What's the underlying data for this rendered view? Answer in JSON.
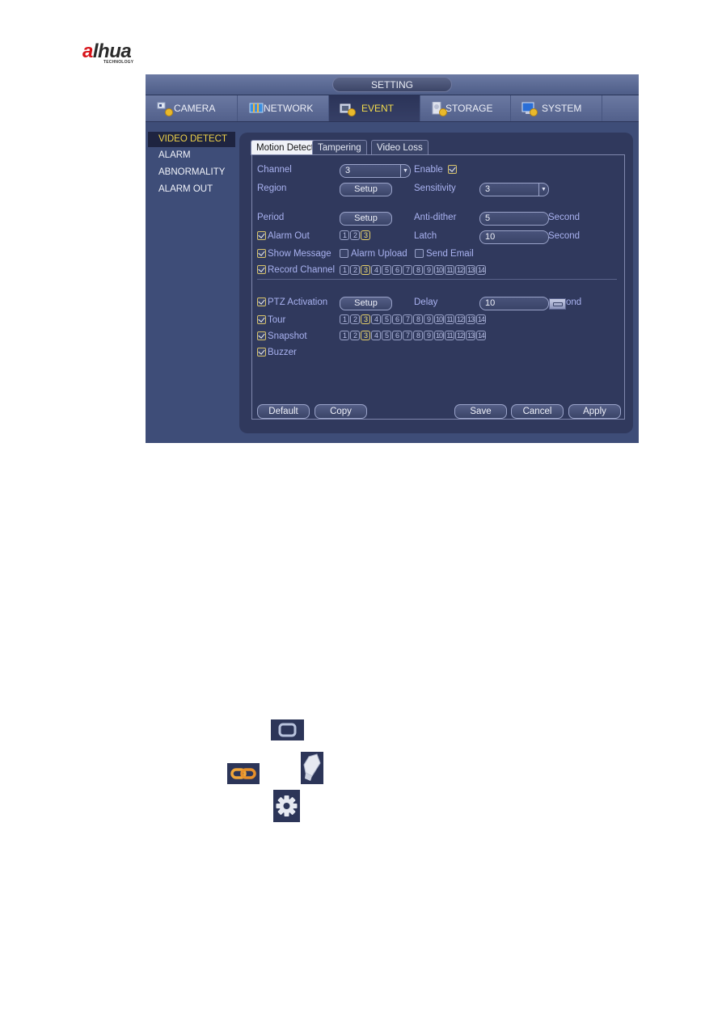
{
  "logo": {
    "brand": "alhua",
    "brand_accent": "a",
    "brand_rest": "lhua",
    "tagline": "TECHNOLOGY"
  },
  "window": {
    "title": "SETTING",
    "tabs": [
      {
        "label": "CAMERA",
        "icon": "camera-settings-icon",
        "active": false
      },
      {
        "label": "NETWORK",
        "icon": "network-icon",
        "active": false
      },
      {
        "label": "EVENT",
        "icon": "event-icon",
        "active": true
      },
      {
        "label": "STORAGE",
        "icon": "storage-icon",
        "active": false
      },
      {
        "label": "SYSTEM",
        "icon": "system-monitor-icon",
        "active": false
      }
    ],
    "active_color": "#f3dc4c"
  },
  "sidebar": {
    "items": [
      {
        "label": "VIDEO DETECT",
        "active": true
      },
      {
        "label": "ALARM",
        "active": false
      },
      {
        "label": "ABNORMALITY",
        "active": false
      },
      {
        "label": "ALARM OUT",
        "active": false
      }
    ]
  },
  "subtabs": [
    {
      "label": "Motion Detect",
      "active": true
    },
    {
      "label": "Tampering",
      "active": false
    },
    {
      "label": "Video Loss",
      "active": false
    }
  ],
  "form": {
    "channel": {
      "label": "Channel",
      "value": "3"
    },
    "enable": {
      "label": "Enable",
      "checked": true
    },
    "region": {
      "label": "Region",
      "button": "Setup"
    },
    "sensitivity": {
      "label": "Sensitivity",
      "value": "3"
    },
    "period": {
      "label": "Period",
      "button": "Setup"
    },
    "anti_dither": {
      "label": "Anti-dither",
      "value": "5",
      "unit": "Second"
    },
    "alarm_out": {
      "label": "Alarm Out",
      "checked": true,
      "options": [
        "1",
        "2",
        "3"
      ],
      "selected": [
        "3"
      ]
    },
    "latch": {
      "label": "Latch",
      "value": "10",
      "unit": "Second"
    },
    "show_message": {
      "label": "Show Message",
      "checked": true
    },
    "alarm_upload": {
      "label": "Alarm Upload",
      "checked": false
    },
    "send_email": {
      "label": "Send Email",
      "checked": false
    },
    "record_channel": {
      "label": "Record Channel",
      "checked": true,
      "options": [
        "1",
        "2",
        "3",
        "4",
        "5",
        "6",
        "7",
        "8",
        "9",
        "10",
        "11",
        "12",
        "13",
        "14"
      ],
      "selected": [
        "3"
      ]
    },
    "ptz_activation": {
      "label": "PTZ Activation",
      "checked": true,
      "button": "Setup"
    },
    "delay": {
      "label": "Delay",
      "value": "10",
      "unit_visible": "ond"
    },
    "tour": {
      "label": "Tour",
      "checked": true,
      "options": [
        "1",
        "2",
        "3",
        "4",
        "5",
        "6",
        "7",
        "8",
        "9",
        "10",
        "11",
        "12",
        "13",
        "14"
      ],
      "selected": [
        "3"
      ]
    },
    "snapshot": {
      "label": "Snapshot",
      "checked": true,
      "options": [
        "1",
        "2",
        "3",
        "4",
        "5",
        "6",
        "7",
        "8",
        "9",
        "10",
        "11",
        "12",
        "13",
        "14"
      ],
      "selected": [
        "3"
      ]
    },
    "buzzer": {
      "label": "Buzzer",
      "checked": true
    }
  },
  "buttons": {
    "default": "Default",
    "copy": "Copy",
    "save": "Save",
    "cancel": "Cancel",
    "apply": "Apply"
  },
  "doc_icons": [
    {
      "name": "window-frame-icon"
    },
    {
      "name": "chain-link-icon"
    },
    {
      "name": "eraser-icon"
    },
    {
      "name": "gear-icon"
    }
  ]
}
